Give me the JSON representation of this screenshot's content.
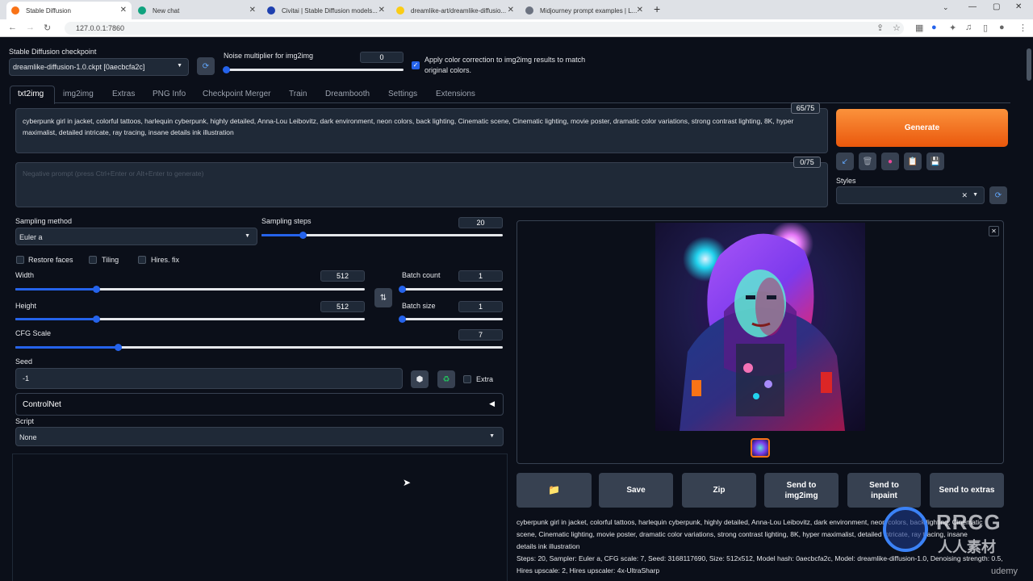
{
  "browser": {
    "tabs": [
      {
        "title": "Stable Diffusion",
        "color": "#f97316"
      },
      {
        "title": "New chat",
        "color": "#10a37f"
      },
      {
        "title": "Civitai | Stable Diffusion models...",
        "color": "#1e40af"
      },
      {
        "title": "dreamlike-art/dreamlike-diffusio...",
        "color": "#facc15"
      },
      {
        "title": "Midjourney prompt examples | L...",
        "color": "#6b7280"
      }
    ],
    "url": "127.0.0.1:7860"
  },
  "top": {
    "checkpoint_label": "Stable Diffusion checkpoint",
    "checkpoint_value": "dreamlike-diffusion-1.0.ckpt [0aecbcfa2c]",
    "noise_label": "Noise multiplier for img2img",
    "noise_value": "0",
    "color_correction_label": "Apply color correction to img2img results to match original colors."
  },
  "tabs": [
    "txt2img",
    "img2img",
    "Extras",
    "PNG Info",
    "Checkpoint Merger",
    "Train",
    "Dreambooth",
    "Settings",
    "Extensions"
  ],
  "prompt": {
    "text": "cyberpunk girl in jacket, colorful tattoos, harlequin cyberpunk, highly detailed, Anna-Lou Leibovitz, dark environment, neon colors, back lighting, Cinematic scene, Cinematic lighting, movie poster, dramatic color variations, strong contrast lighting, 8K, hyper maximalist, detailed intricate, ray tracing, insane details ink illustration",
    "token_count": "65/75",
    "negative_placeholder": "Negative prompt (press Ctrl+Enter or Alt+Enter to generate)",
    "negative_token_count": "0/75"
  },
  "generate_label": "Generate",
  "styles_label": "Styles",
  "settings": {
    "sampling_method_label": "Sampling method",
    "sampling_method_value": "Euler a",
    "sampling_steps_label": "Sampling steps",
    "sampling_steps_value": "20",
    "restore_faces": "Restore faces",
    "tiling": "Tiling",
    "hires_fix": "Hires. fix",
    "width_label": "Width",
    "width_value": "512",
    "height_label": "Height",
    "height_value": "512",
    "batch_count_label": "Batch count",
    "batch_count_value": "1",
    "batch_size_label": "Batch size",
    "batch_size_value": "1",
    "cfg_label": "CFG Scale",
    "cfg_value": "7",
    "seed_label": "Seed",
    "seed_value": "-1",
    "extra_label": "Extra",
    "controlnet_label": "ControlNet",
    "script_label": "Script",
    "script_value": "None"
  },
  "slider_levels": {
    "noise": 0.0,
    "steps": 0.17,
    "width": 0.23,
    "height": 0.23,
    "batch_count": 0.0,
    "batch_size": 0.0,
    "cfg": 0.21
  },
  "output": {
    "buttons": [
      "Save",
      "Zip",
      "Send to img2img",
      "Send to inpaint",
      "Send to extras"
    ],
    "info_line1": "cyberpunk girl in jacket, colorful tattoos, harlequin cyberpunk, highly detailed, Anna-Lou Leibovitz, dark environment, neon colors, back lighting, Cinematic",
    "info_line2": "scene, Cinematic lighting, movie poster, dramatic color variations, strong contrast lighting, 8K, hyper maximalist, detailed intricate, ray tracing, insane",
    "info_line3": "details ink illustration",
    "info_line4": "Steps: 20, Sampler: Euler a, CFG scale: 7, Seed: 3168117690, Size: 512x512, Model hash: 0aecbcfa2c, Model: dreamlike-diffusion-1.0, Denoising strength: 0.5,",
    "info_line5": "Hires upscale: 2, Hires upscaler: 4x-UltraSharp"
  },
  "watermark": {
    "brand": "RRCG",
    "sub": "人人素材",
    "udemy": "udemy"
  },
  "colors": {
    "accent": "#2563eb",
    "generate": "#f97316",
    "bg": "#0b0f19"
  }
}
